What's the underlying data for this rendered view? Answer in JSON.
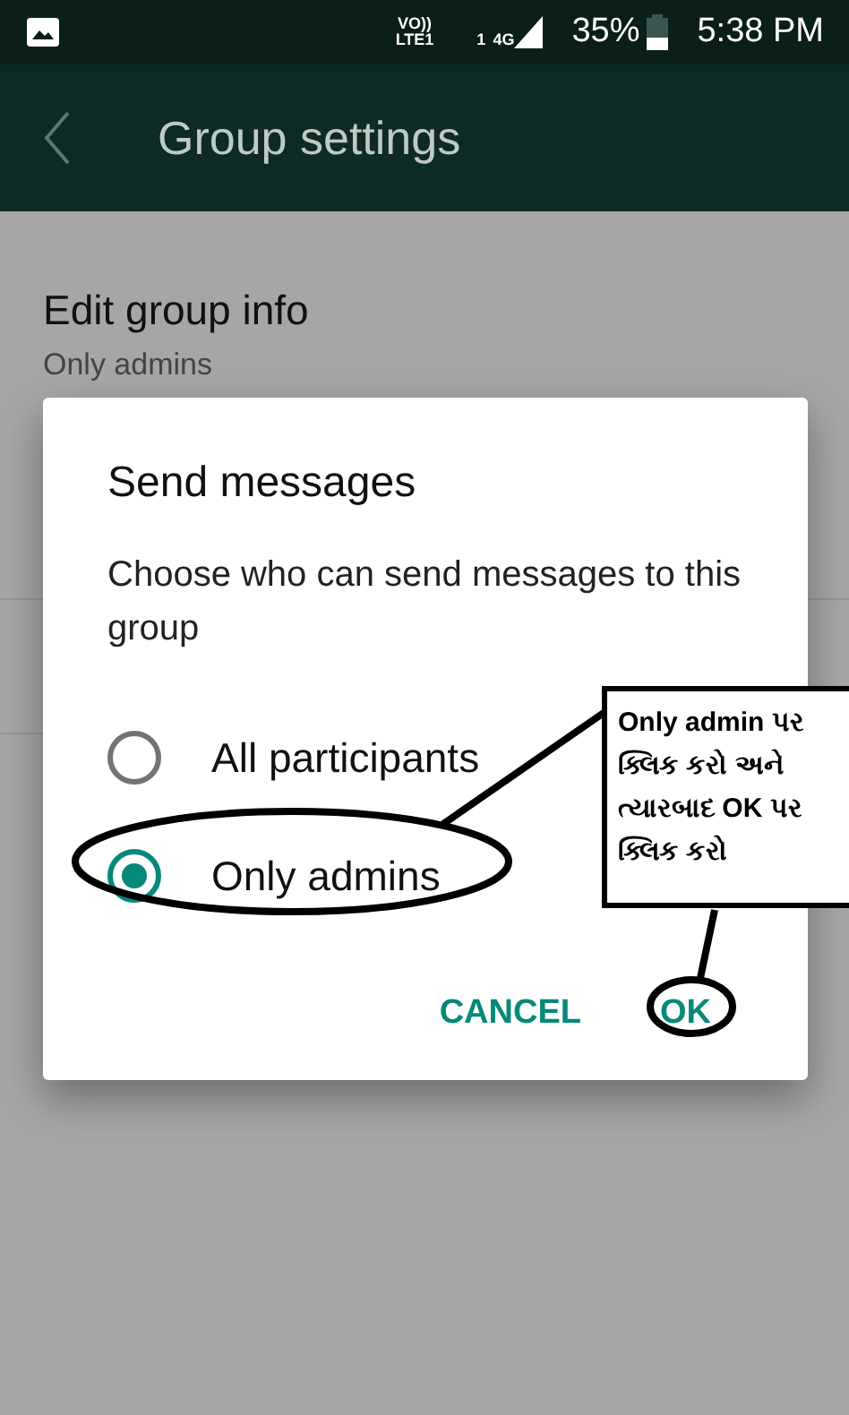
{
  "status_bar": {
    "volte_top": "VO))",
    "volte_bottom": "LTE1",
    "network_type": "4G",
    "sim_slot": "1",
    "battery": "35%",
    "time": "5:38 PM"
  },
  "toolbar": {
    "title": "Group settings"
  },
  "settings": [
    {
      "title": "Edit group info",
      "value": "Only admins"
    }
  ],
  "dialog": {
    "title": "Send messages",
    "message": "Choose who can send messages to this group",
    "options": [
      {
        "label": "All participants",
        "selected": false
      },
      {
        "label": "Only admins",
        "selected": true
      }
    ],
    "buttons": [
      {
        "label": "CANCEL"
      },
      {
        "label": "OK"
      }
    ]
  },
  "annotation": {
    "note": "Only admin પર ક્લિક કરો અને ત્યારબાદ OK પર ક્લિક કરો"
  }
}
